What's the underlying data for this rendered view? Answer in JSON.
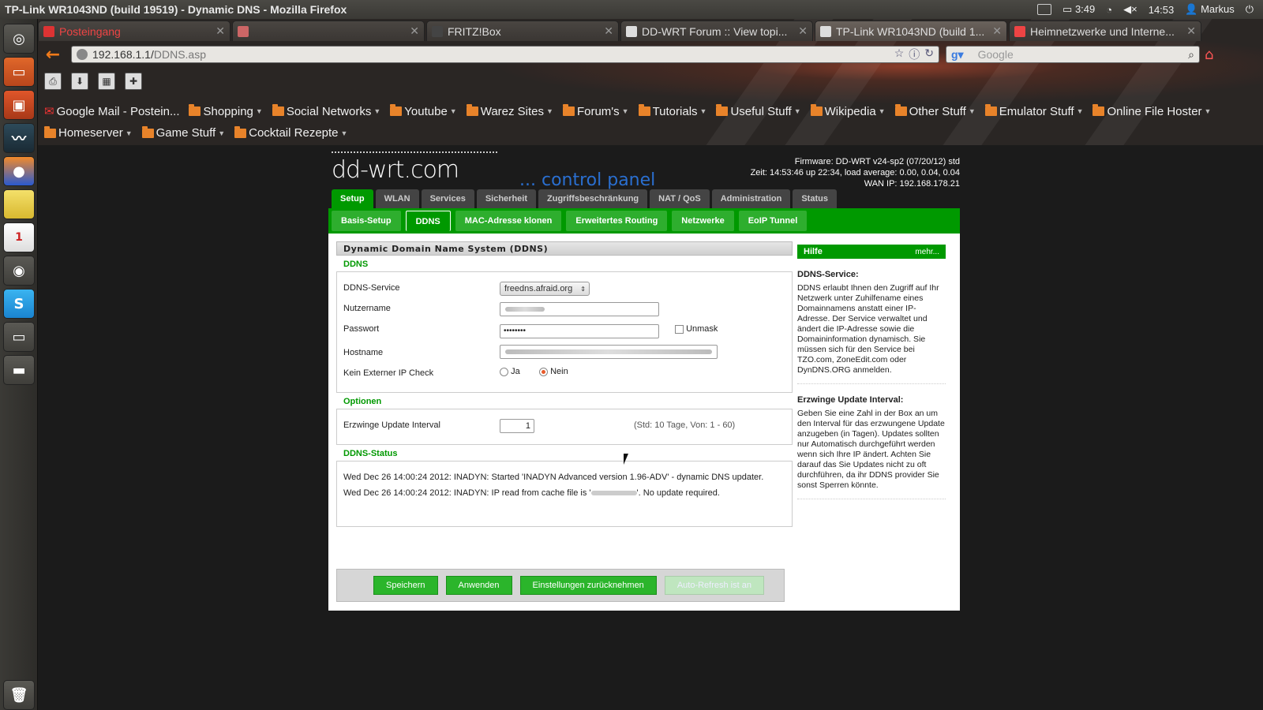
{
  "window": {
    "title": "TP-Link WR1043ND (build 19519) - Dynamic DNS - Mozilla Firefox"
  },
  "system": {
    "battery": "3:49",
    "clock": "14:53",
    "user": "Markus"
  },
  "launcher": [
    {
      "name": "ubuntu-dash-icon"
    },
    {
      "name": "files-icon"
    },
    {
      "name": "software-center-icon"
    },
    {
      "name": "system-monitor-icon"
    },
    {
      "name": "firefox-icon"
    },
    {
      "name": "notes-icon"
    },
    {
      "name": "calendar-icon"
    },
    {
      "name": "gimp-icon"
    },
    {
      "name": "skype-icon"
    },
    {
      "name": "window-icon"
    },
    {
      "name": "drive-icon"
    }
  ],
  "tabs": [
    {
      "label": "Posteingang",
      "active": false
    },
    {
      "label": "",
      "active": false
    },
    {
      "label": "FRITZ!Box",
      "active": false
    },
    {
      "label": "DD-WRT Forum :: View topi...",
      "active": false
    },
    {
      "label": "TP-Link WR1043ND (build 1...",
      "active": true
    },
    {
      "label": "Heimnetzwerke und Interne...",
      "active": false
    }
  ],
  "url": {
    "host": "192.168.1.1/",
    "path": "DDNS.asp"
  },
  "search": {
    "placeholder": "Google"
  },
  "bookmarks_row1": [
    "Google Mail - Postein...",
    "Shopping",
    "Social Networks",
    "Youtube",
    "Warez Sites",
    "Forum's",
    "Tutorials",
    "Useful Stuff",
    "Wikipedia",
    "Other Stuff",
    "Emulator Stuff",
    "Online File Hoster"
  ],
  "bookmarks_row2": [
    "Homeserver",
    "Game Stuff",
    "Cocktail Rezepte"
  ],
  "ddwrt": {
    "logo": "dd-wrt.com",
    "cpanel": "... control panel",
    "firmware": "Firmware: DD-WRT v24-sp2 (07/20/12) std",
    "uptime": "Zeit: 14:53:46 up 22:34, load average: 0.00, 0.04, 0.04",
    "wanip": "WAN IP: 192.168.178.21",
    "main_tabs": [
      "Setup",
      "WLAN",
      "Services",
      "Sicherheit",
      "Zugriffsbeschränkung",
      "NAT / QoS",
      "Administration",
      "Status"
    ],
    "sub_tabs": [
      "Basis-Setup",
      "DDNS",
      "MAC-Adresse klonen",
      "Erweitertes Routing",
      "Netzwerke",
      "EoIP Tunnel"
    ],
    "section_title": "Dynamic Domain Name System (DDNS)",
    "ddns_legend": "DDNS",
    "labels": {
      "service": "DDNS-Service",
      "user": "Nutzername",
      "password": "Passwort",
      "hostname": "Hostname",
      "no_ext_ip": "Kein Externer IP Check",
      "unmask": "Unmask",
      "ja": "Ja",
      "nein": "Nein"
    },
    "values": {
      "service": "freedns.afraid.org",
      "password": "••••••••"
    },
    "options_legend": "Optionen",
    "interval_label": "Erzwinge Update Interval",
    "interval_value": "1",
    "interval_hint": "(Std: 10 Tage, Von: 1 - 60)",
    "status_legend": "DDNS-Status",
    "status_line1": "Wed Dec 26 14:00:24 2012: INADYN: Started 'INADYN Advanced version 1.96-ADV' - dynamic DNS updater.",
    "status_line2a": "Wed Dec 26 14:00:24 2012: INADYN: IP read from cache file is '",
    "status_line2b": "'. No update required.",
    "buttons": [
      "Speichern",
      "Anwenden",
      "Einstellungen zurücknehmen",
      "Auto-Refresh ist an"
    ],
    "help": {
      "title": "Hilfe",
      "more": "mehr...",
      "t1": "DDNS-Service:",
      "b1": "DDNS erlaubt Ihnen den Zugriff auf Ihr Netzwerk unter Zuhilfename eines Domainnamens anstatt einer IP-Adresse. Der Service verwaltet und ändert die IP-Adresse sowie die Domaininformation dynamisch. Sie müssen sich für den Service bei TZO.com, ZoneEdit.com oder DynDNS.ORG anmelden.",
      "t2": "Erzwinge Update Interval:",
      "b2": "Geben Sie eine Zahl in der Box an um den Interval für das erzwungene Update anzugeben (in Tagen). Updates sollten nur Automatisch durchgeführt werden wenn sich Ihre IP ändert. Achten Sie darauf das Sie Updates nicht zu oft durchführen, da ihr DDNS provider Sie sonst Sperren könnte."
    }
  }
}
